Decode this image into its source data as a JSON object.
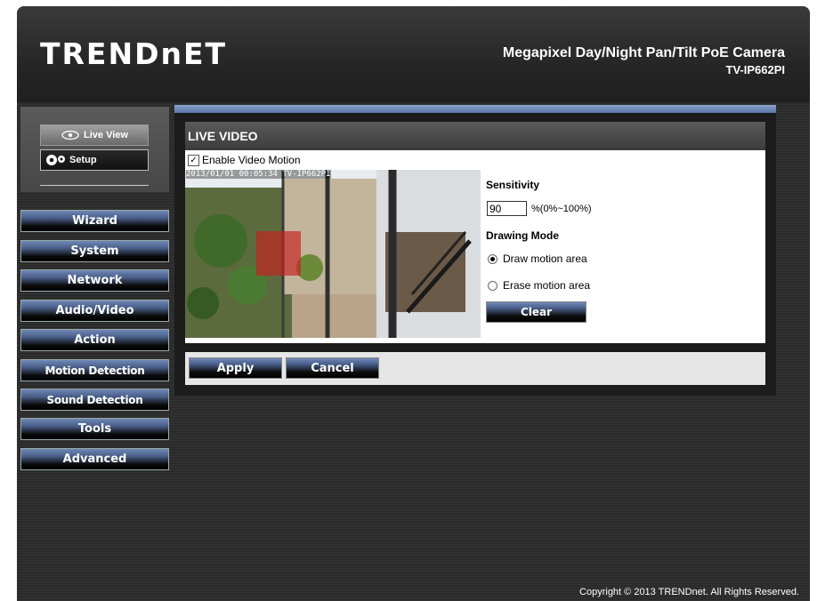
{
  "brand": {
    "logo_text": "TRENDnET",
    "product_name": "Megapixel Day/Night Pan/Tilt PoE Camera",
    "model": "TV-IP662PI"
  },
  "sidebar": {
    "live_view_label": "Live View",
    "setup_label": "Setup",
    "items": [
      {
        "label": "Wizard"
      },
      {
        "label": "System"
      },
      {
        "label": "Network"
      },
      {
        "label": "Audio/Video"
      },
      {
        "label": "Action"
      },
      {
        "label": "Motion Detection"
      },
      {
        "label": "Sound Detection"
      },
      {
        "label": "Tools"
      },
      {
        "label": "Advanced"
      }
    ]
  },
  "main": {
    "title": "LIVE VIDEO",
    "enable_motion": {
      "label": "Enable Video Motion",
      "checked": true,
      "check_glyph": "✓"
    },
    "video_timestamp": "2013/01/01 00:05:34 TV-IP662PI",
    "sensitivity": {
      "label": "Sensitivity",
      "value": "90",
      "range": "%(0%~100%)"
    },
    "drawing_mode": {
      "label": "Drawing Mode",
      "options": [
        {
          "label": "Draw motion area",
          "selected": true
        },
        {
          "label": "Erase motion area",
          "selected": false
        }
      ]
    },
    "clear_label": "Clear",
    "apply_label": "Apply",
    "cancel_label": "Cancel"
  },
  "footer": {
    "copyright": "Copyright © 2013 TRENDnet. All Rights Reserved."
  },
  "colors": {
    "accent_blue": "#5b77a8",
    "motion_area": "#c81e1e"
  }
}
